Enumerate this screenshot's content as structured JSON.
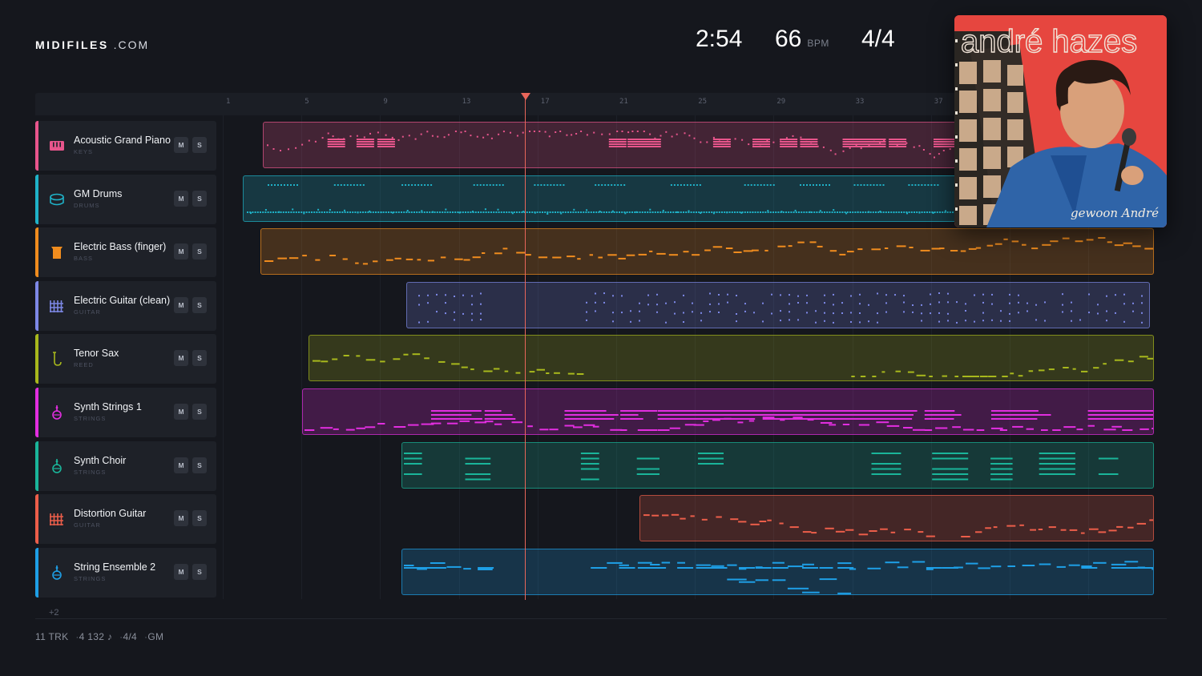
{
  "brand": {
    "name": "MIDIFILES",
    "suffix": ".COM"
  },
  "header": {
    "duration": "2:54",
    "tempo": "66",
    "tempo_unit": "BPM",
    "time_signature": "4/4"
  },
  "album": {
    "artist": "andré hazes",
    "title": "gewoon André"
  },
  "ruler": {
    "bars": [
      "1",
      "5",
      "9",
      "13",
      "17",
      "21",
      "25",
      "29",
      "33",
      "37"
    ]
  },
  "tracks": [
    {
      "name": "Acoustic Grand Piano",
      "category": "KEYS",
      "color": "#e8558c",
      "icon": "piano-icon",
      "mute": "M",
      "solo": "S"
    },
    {
      "name": "GM Drums",
      "category": "DRUMS",
      "color": "#1fb2c8",
      "icon": "drum-icon",
      "mute": "M",
      "solo": "S"
    },
    {
      "name": "Electric Bass (finger)",
      "category": "BASS",
      "color": "#f08c1e",
      "icon": "bass-icon",
      "mute": "M",
      "solo": "S"
    },
    {
      "name": "Electric Guitar (clean)",
      "category": "GUITAR",
      "color": "#7d88e6",
      "icon": "guitar-icon",
      "mute": "M",
      "solo": "S"
    },
    {
      "name": "Tenor Sax",
      "category": "REED",
      "color": "#a8b81c",
      "icon": "sax-icon",
      "mute": "M",
      "solo": "S"
    },
    {
      "name": "Synth Strings 1",
      "category": "STRINGS",
      "color": "#e22ee0",
      "icon": "strings-icon",
      "mute": "M",
      "solo": "S"
    },
    {
      "name": "Synth Choir",
      "category": "STRINGS",
      "color": "#1ab59a",
      "icon": "strings-icon",
      "mute": "M",
      "solo": "S"
    },
    {
      "name": "Distortion Guitar",
      "category": "GUITAR",
      "color": "#ec5e4a",
      "icon": "guitar-icon",
      "mute": "M",
      "solo": "S"
    },
    {
      "name": "String Ensemble 2",
      "category": "STRINGS",
      "color": "#1e9fe6",
      "icon": "strings-icon",
      "mute": "M",
      "solo": "S"
    }
  ],
  "more_tracks": "+2",
  "footer": {
    "tracks": "11 TRK",
    "notes": "4 132 ♪",
    "time_signature": "4/4",
    "standard": "GM"
  }
}
